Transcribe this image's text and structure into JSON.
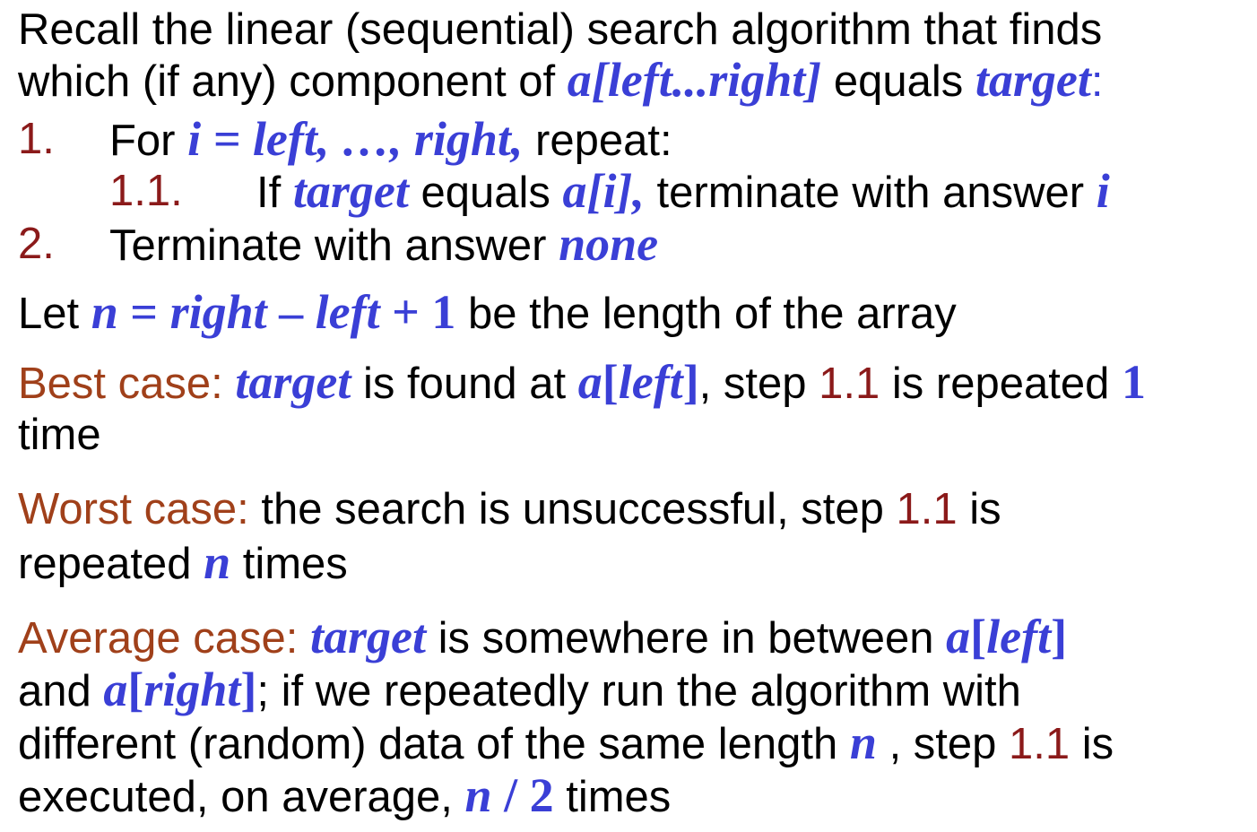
{
  "intro": {
    "line1": "Recall the linear (sequential) search algorithm that finds",
    "line2_pre": "which (if any) component of ",
    "line2_var": "a[left...right]",
    "line2_mid": " equals ",
    "line2_target": "target",
    "line2_end": ":"
  },
  "steps": {
    "s1_num": "1.",
    "s1_pre": "For ",
    "s1_expr": "i = left, …, right,",
    "s1_post": " repeat:",
    "s11_num": "1.1.",
    "s11_pre": "If ",
    "s11_target": "target",
    "s11_mid": " equals ",
    "s11_ai": "a[i],",
    "s11_post": " terminate with answer ",
    "s11_i": "i",
    "s2_num": "2.",
    "s2_pre": "Terminate with answer ",
    "s2_none": "none"
  },
  "let": {
    "pre": "Let ",
    "n": "n",
    "eq": " = ",
    "right": "right",
    "minus": " – ",
    "left": "left",
    "plus": " + 1",
    "post": " be the length of the array"
  },
  "best": {
    "label": "Best case:",
    "target": "target",
    "t1": " is found at ",
    "aleft_a": "a",
    "aleft_b1": "[",
    "aleft_left": "left",
    "aleft_b2": "]",
    "t2": ", step ",
    "step": "1.1",
    "t3": " is repeated ",
    "one": "1",
    "line2": "time"
  },
  "worst": {
    "label": "Worst case:",
    "t1": " the search is unsuccessful, step ",
    "step": "1.1",
    "t2": " is",
    "l2_pre": "repeated ",
    "n": "n",
    "l2_post": " times"
  },
  "average": {
    "label": "Average case:",
    "target": "target",
    "t1": " is somewhere in between ",
    "aleft_a": "a",
    "aleft_b1": "[",
    "aleft_left": "left",
    "aleft_b2": "]",
    "l2_pre": "and ",
    "aright_a": "a",
    "aright_b1": "[",
    "aright_right": "right",
    "aright_b2": "]",
    "l2_post": "; if we repeatedly run the algorithm with",
    "l3_pre": "different (random) data of the same length ",
    "n": "n",
    "l3_mid": " , step ",
    "step": "1.1",
    "l3_post": " is",
    "l4_pre": "executed, on average, ",
    "n2": "n",
    "div": " / 2",
    "l4_post": " times"
  }
}
